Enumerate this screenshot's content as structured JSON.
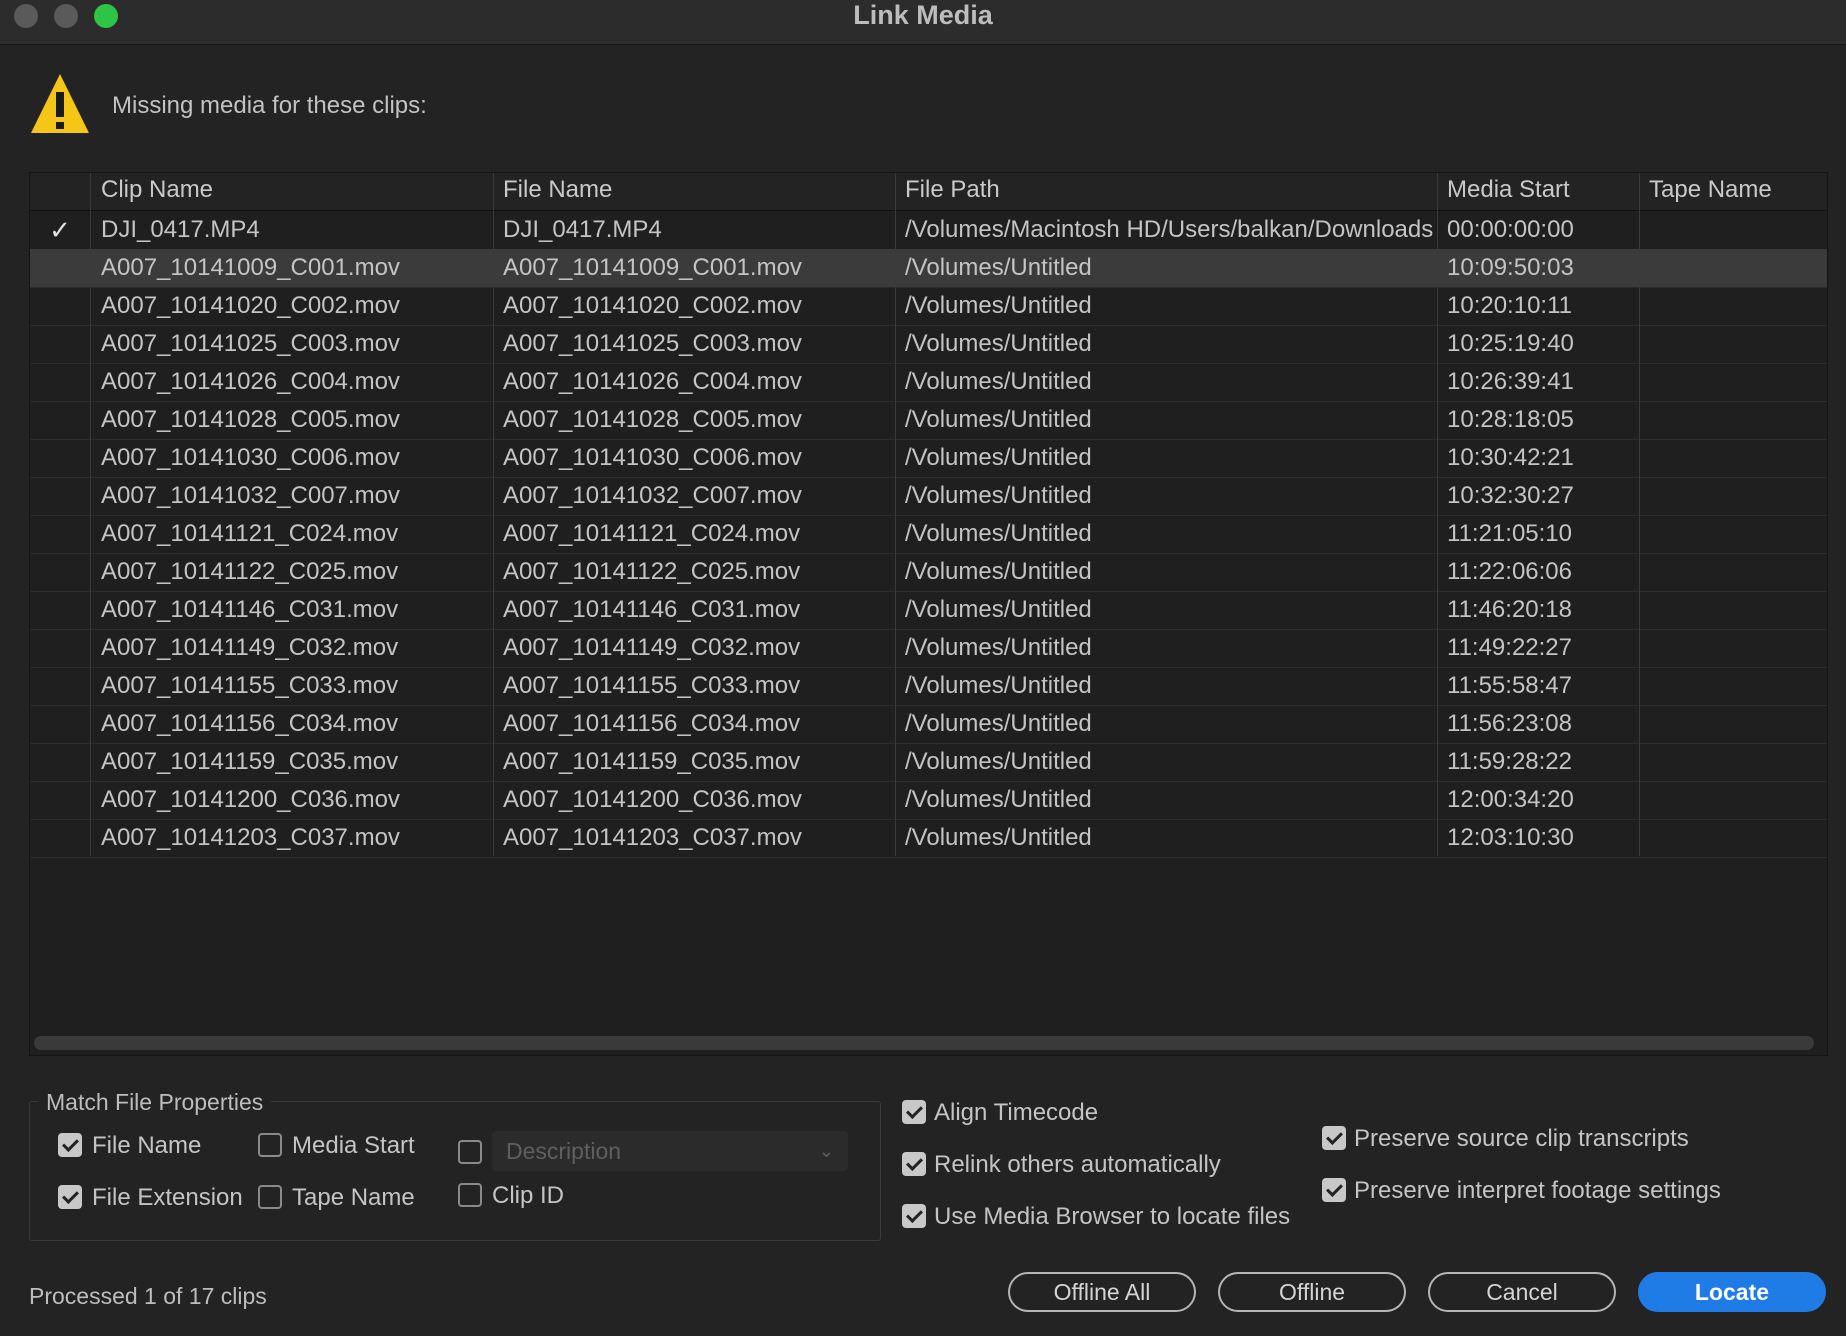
{
  "window": {
    "title": "Link Media"
  },
  "header": {
    "warning_icon": "warning-icon",
    "message": "Missing media for these clips:"
  },
  "table": {
    "columns": [
      "Clip Name",
      "File Name",
      "File Path",
      "Media Start",
      "Tape Name"
    ],
    "rows": [
      {
        "checked": true,
        "clip": "DJI_0417.MP4",
        "file": "DJI_0417.MP4",
        "path": "/Volumes/Macintosh HD/Users/balkan/Downloads",
        "start": "00:00:00:00",
        "tape": ""
      },
      {
        "checked": false,
        "selected": true,
        "clip": "A007_10141009_C001.mov",
        "file": "A007_10141009_C001.mov",
        "path": "/Volumes/Untitled",
        "start": "10:09:50:03",
        "tape": ""
      },
      {
        "checked": false,
        "clip": "A007_10141020_C002.mov",
        "file": "A007_10141020_C002.mov",
        "path": "/Volumes/Untitled",
        "start": "10:20:10:11",
        "tape": ""
      },
      {
        "checked": false,
        "clip": "A007_10141025_C003.mov",
        "file": "A007_10141025_C003.mov",
        "path": "/Volumes/Untitled",
        "start": "10:25:19:40",
        "tape": ""
      },
      {
        "checked": false,
        "clip": "A007_10141026_C004.mov",
        "file": "A007_10141026_C004.mov",
        "path": "/Volumes/Untitled",
        "start": "10:26:39:41",
        "tape": ""
      },
      {
        "checked": false,
        "clip": "A007_10141028_C005.mov",
        "file": "A007_10141028_C005.mov",
        "path": "/Volumes/Untitled",
        "start": "10:28:18:05",
        "tape": ""
      },
      {
        "checked": false,
        "clip": "A007_10141030_C006.mov",
        "file": "A007_10141030_C006.mov",
        "path": "/Volumes/Untitled",
        "start": "10:30:42:21",
        "tape": ""
      },
      {
        "checked": false,
        "clip": "A007_10141032_C007.mov",
        "file": "A007_10141032_C007.mov",
        "path": "/Volumes/Untitled",
        "start": "10:32:30:27",
        "tape": ""
      },
      {
        "checked": false,
        "clip": "A007_10141121_C024.mov",
        "file": "A007_10141121_C024.mov",
        "path": "/Volumes/Untitled",
        "start": "11:21:05:10",
        "tape": ""
      },
      {
        "checked": false,
        "clip": "A007_10141122_C025.mov",
        "file": "A007_10141122_C025.mov",
        "path": "/Volumes/Untitled",
        "start": "11:22:06:06",
        "tape": ""
      },
      {
        "checked": false,
        "clip": "A007_10141146_C031.mov",
        "file": "A007_10141146_C031.mov",
        "path": "/Volumes/Untitled",
        "start": "11:46:20:18",
        "tape": ""
      },
      {
        "checked": false,
        "clip": "A007_10141149_C032.mov",
        "file": "A007_10141149_C032.mov",
        "path": "/Volumes/Untitled",
        "start": "11:49:22:27",
        "tape": ""
      },
      {
        "checked": false,
        "clip": "A007_10141155_C033.mov",
        "file": "A007_10141155_C033.mov",
        "path": "/Volumes/Untitled",
        "start": "11:55:58:47",
        "tape": ""
      },
      {
        "checked": false,
        "clip": "A007_10141156_C034.mov",
        "file": "A007_10141156_C034.mov",
        "path": "/Volumes/Untitled",
        "start": "11:56:23:08",
        "tape": ""
      },
      {
        "checked": false,
        "clip": "A007_10141159_C035.mov",
        "file": "A007_10141159_C035.mov",
        "path": "/Volumes/Untitled",
        "start": "11:59:28:22",
        "tape": ""
      },
      {
        "checked": false,
        "clip": "A007_10141200_C036.mov",
        "file": "A007_10141200_C036.mov",
        "path": "/Volumes/Untitled",
        "start": "12:00:34:20",
        "tape": ""
      },
      {
        "checked": false,
        "clip": "A007_10141203_C037.mov",
        "file": "A007_10141203_C037.mov",
        "path": "/Volumes/Untitled",
        "start": "12:03:10:30",
        "tape": ""
      }
    ]
  },
  "match": {
    "legend": "Match File Properties",
    "file_name": {
      "label": "File Name",
      "checked": true
    },
    "media_start": {
      "label": "Media Start",
      "checked": false
    },
    "description": {
      "label": "Description",
      "checked": false
    },
    "file_extension": {
      "label": "File Extension",
      "checked": true
    },
    "tape_name": {
      "label": "Tape Name",
      "checked": false
    },
    "clip_id": {
      "label": "Clip ID",
      "checked": false
    }
  },
  "options": {
    "align_timecode": {
      "label": "Align Timecode",
      "checked": true
    },
    "relink_others": {
      "label": "Relink others automatically",
      "checked": true
    },
    "use_media_browser": {
      "label": "Use Media Browser to locate files",
      "checked": true
    },
    "preserve_transcripts": {
      "label": "Preserve source clip transcripts",
      "checked": true
    },
    "preserve_interpret": {
      "label": "Preserve interpret footage settings",
      "checked": true
    }
  },
  "status": "Processed 1 of 17 clips",
  "buttons": {
    "offline_all": "Offline All",
    "offline": "Offline",
    "cancel": "Cancel",
    "locate": "Locate"
  },
  "colors": {
    "accent": "#1f7ce6",
    "warning": "#f5c518",
    "zoom_light": "#2fc445"
  }
}
